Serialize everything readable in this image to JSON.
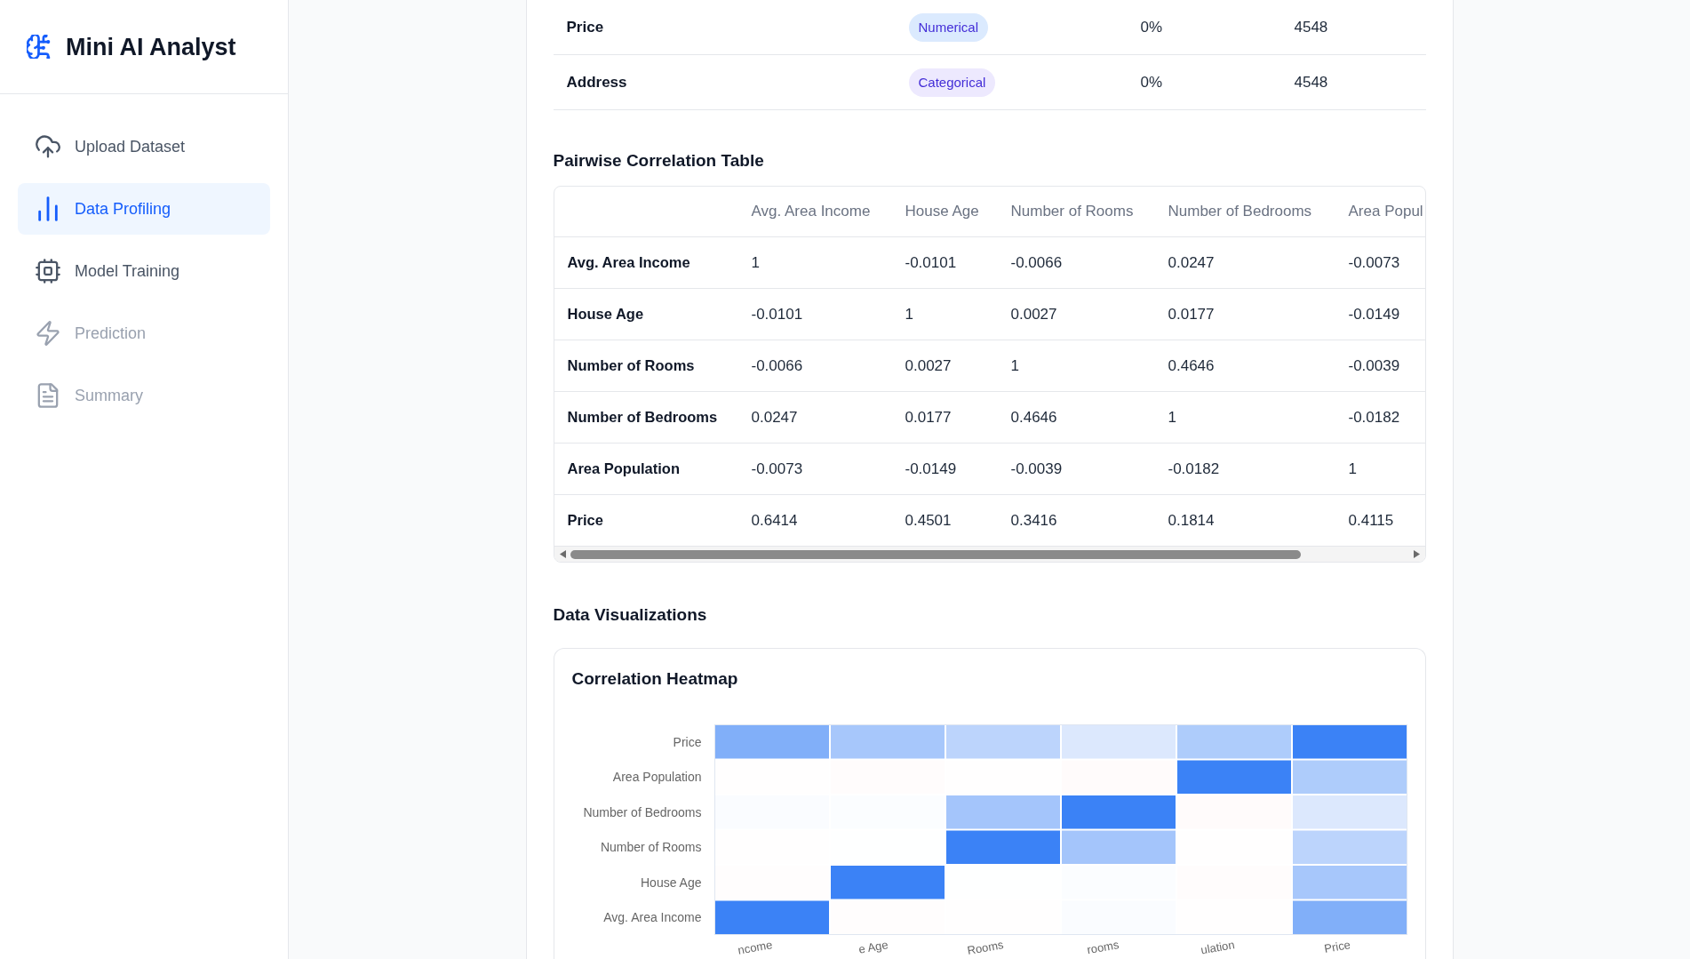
{
  "sidebar": {
    "app_title": "Mini AI Analyst",
    "items": [
      {
        "label": "Upload Dataset",
        "kind": "upload",
        "selected": false,
        "disabled": false
      },
      {
        "label": "Data Profiling",
        "kind": "profiling",
        "selected": true,
        "disabled": false
      },
      {
        "label": "Model Training",
        "kind": "training",
        "selected": false,
        "disabled": false
      },
      {
        "label": "Prediction",
        "kind": "prediction",
        "selected": false,
        "disabled": true
      },
      {
        "label": "Summary",
        "kind": "summary",
        "selected": false,
        "disabled": true
      }
    ]
  },
  "column_table": {
    "rows": [
      {
        "name": "Price",
        "type": {
          "label": "Numerical",
          "kind": "numerical"
        },
        "column_3": "0%",
        "column_4": "4548"
      },
      {
        "name": "Address",
        "type": {
          "label": "Categorical",
          "kind": "categorical"
        },
        "column_3": "0%",
        "column_4": "4548"
      }
    ]
  },
  "correlation_table": {
    "title": "Pairwise Correlation Table",
    "columns": [
      "Avg. Area Income",
      "House Age",
      "Number of Rooms",
      "Number of Bedrooms",
      "Area Popul"
    ],
    "rows": [
      {
        "label": "Avg. Area Income",
        "values": [
          "1",
          "-0.0101",
          "-0.0066",
          "0.0247",
          "-0.0073"
        ]
      },
      {
        "label": "House Age",
        "values": [
          "-0.0101",
          "1",
          "0.0027",
          "0.0177",
          "-0.0149"
        ]
      },
      {
        "label": "Number of Rooms",
        "values": [
          "-0.0066",
          "0.0027",
          "1",
          "0.4646",
          "-0.0039"
        ]
      },
      {
        "label": "Number of Bedrooms",
        "values": [
          "0.0247",
          "0.0177",
          "0.4646",
          "1",
          "-0.0182"
        ]
      },
      {
        "label": "Area Population",
        "values": [
          "-0.0073",
          "-0.0149",
          "-0.0039",
          "-0.0182",
          "1"
        ]
      },
      {
        "label": "Price",
        "values": [
          "0.6414",
          "0.4501",
          "0.3416",
          "0.1814",
          "0.4115"
        ]
      }
    ]
  },
  "visualizations": {
    "title": "Data Visualizations",
    "heatmap": {
      "title": "Correlation Heatmap",
      "y_labels": [
        "Price",
        "Area Population",
        "Number of Bedrooms",
        "Number of Rooms",
        "House Age",
        "Avg. Area Income"
      ],
      "x_labels": [
        "ncome",
        "e Age",
        "Rooms",
        "rooms",
        "ulation",
        "Price"
      ]
    }
  }
}
